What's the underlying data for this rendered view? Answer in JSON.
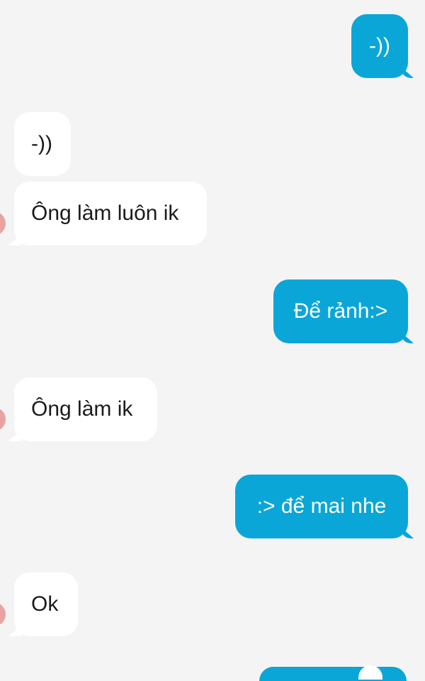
{
  "conversation": {
    "messages": [
      {
        "side": "outgoing",
        "text": "-))"
      },
      {
        "side": "incoming",
        "text": "-))"
      },
      {
        "side": "incoming",
        "text": "Ông làm luôn ik"
      },
      {
        "side": "outgoing",
        "text": "Để rảnh:>"
      },
      {
        "side": "incoming",
        "text": "Ông làm ik"
      },
      {
        "side": "outgoing",
        "text": ":> để mai nhe"
      },
      {
        "side": "incoming",
        "text": "Ok"
      }
    ]
  },
  "colors": {
    "background": "#f4f4f4",
    "incoming_bubble": "#ffffff",
    "outgoing_bubble": "#0aa6d8",
    "incoming_text": "#1b1b1b",
    "outgoing_text": "#ffffff"
  },
  "icons": {
    "sender_avatar": "avatar"
  }
}
